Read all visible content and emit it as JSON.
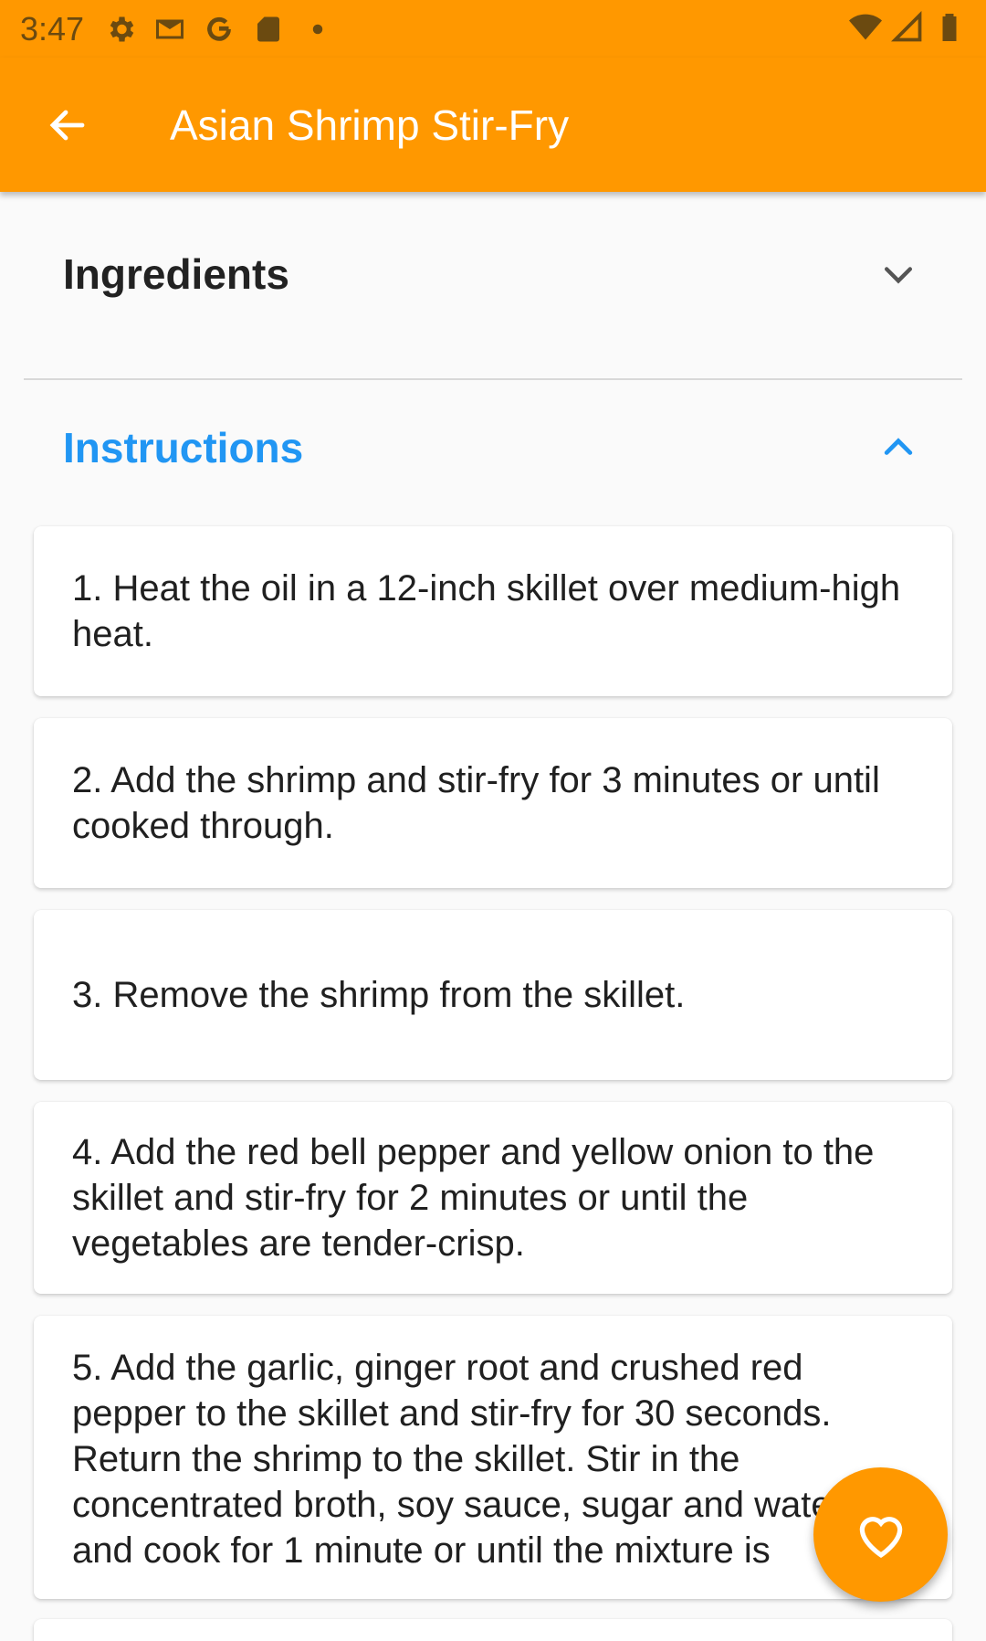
{
  "status_bar": {
    "time": "3:47",
    "icons_left": [
      "settings-icon",
      "gmail-icon",
      "google-icon",
      "sd-card-icon",
      "dot-icon"
    ],
    "icons_right": [
      "wifi-icon",
      "signal-icon",
      "battery-icon"
    ]
  },
  "app_bar": {
    "title": "Asian Shrimp Stir-Fry",
    "back_icon": "arrow-back-icon",
    "color": "#ff9800"
  },
  "sections": {
    "ingredients": {
      "title": "Ingredients",
      "expanded": false
    },
    "instructions": {
      "title": "Instructions",
      "expanded": true,
      "accent": "#2196f3"
    }
  },
  "instructions": [
    "1. Heat the oil in a 12-inch skillet over medium-high heat.",
    "2. Add the shrimp and stir-fry for 3 minutes or until cooked through.",
    "3. Remove the shrimp from the skillet.",
    "4. Add the red bell pepper and yellow onion to the skillet and stir-fry for 2 minutes or until the vegetables are tender-crisp.",
    "5. Add the garlic, ginger root and crushed red pepper to the skillet and stir-fry for 30 seconds. Return the shrimp to the skillet. Stir in the concentrated broth, soy sauce, sugar and water and cook for 1 minute or until the mixture is"
  ],
  "fab": {
    "icon": "heart-outline-icon",
    "color": "#ff9800"
  }
}
